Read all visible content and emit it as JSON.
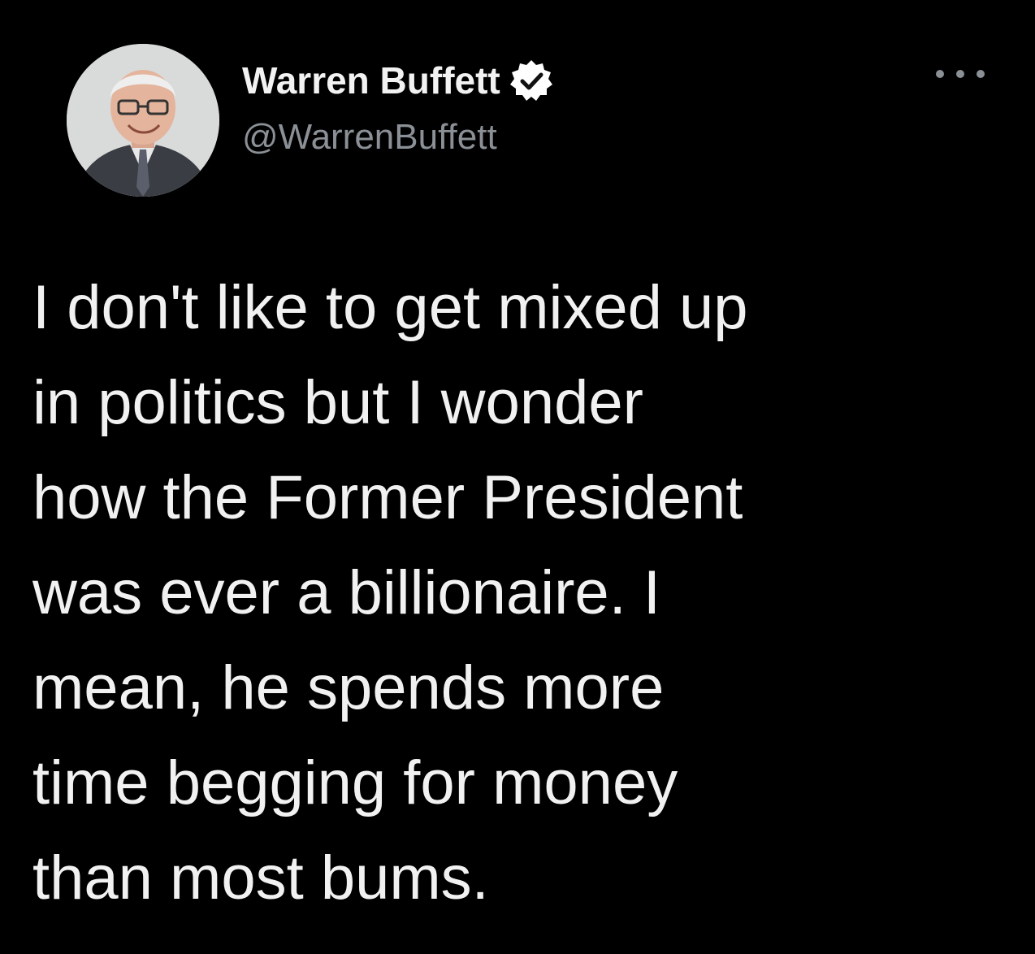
{
  "author": {
    "display_name": "Warren Buffett",
    "handle": "@WarrenBuffett",
    "verified": true,
    "avatar_icon": "avatar-photo"
  },
  "more_icon": "more-horizontal-icon",
  "tweet": {
    "lines": [
      "I don't like to get mixed up",
      "in politics but I wonder",
      "how the Former President",
      "was ever a billionaire. I",
      "mean, he spends more",
      "time begging for money",
      "than most bums."
    ]
  },
  "colors": {
    "background": "#000000",
    "name": "#f2f2f2",
    "handle": "#8b9096",
    "text": "#f1f1f1",
    "badge": "#ffffff"
  }
}
